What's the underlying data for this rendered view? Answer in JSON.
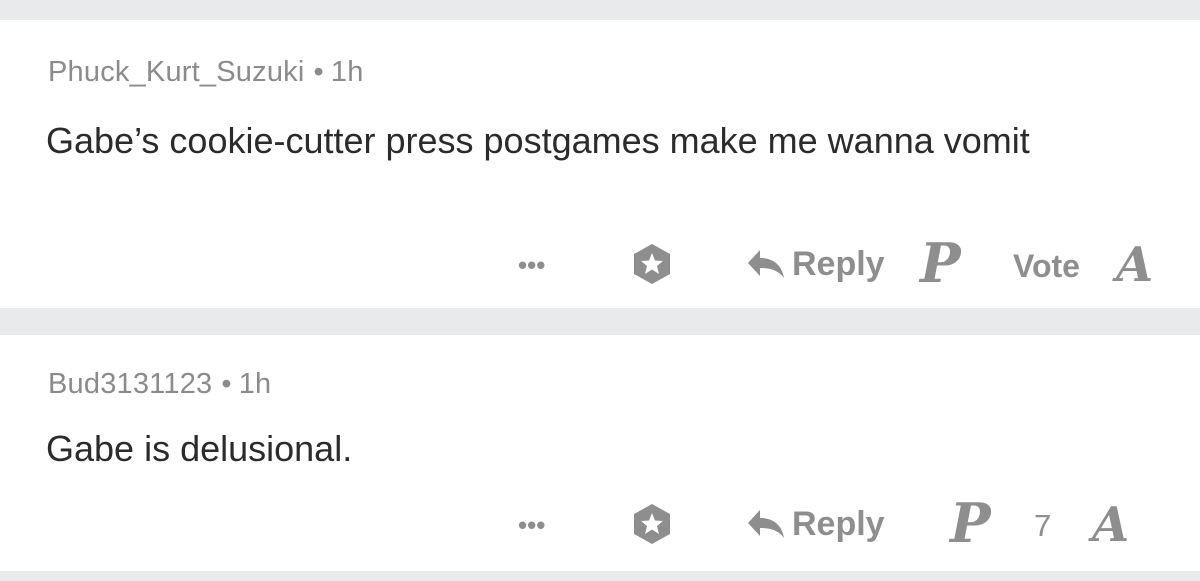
{
  "comments": [
    {
      "username": "Phuck_Kurt_Suzuki",
      "separator": "•",
      "age": "1h",
      "text": "Gabe’s cookie-cutter press postgames make me wanna vomit",
      "actions": {
        "more": "•••",
        "award_icon": "award-icon",
        "reply_label": "Reply",
        "team_logo_left": "P",
        "vote_label": "Vote",
        "team_logo_right": "A"
      }
    },
    {
      "username": "Bud3131123",
      "separator": "•",
      "age": "1h",
      "text": "Gabe is delusional.",
      "actions": {
        "more": "•••",
        "award_icon": "award-icon",
        "reply_label": "Reply",
        "team_logo_left": "P",
        "vote_label": "7",
        "team_logo_right": "A"
      }
    }
  ],
  "colors": {
    "background": "#e9eaec",
    "card": "#ffffff",
    "meta_text": "#8b8b8b",
    "body_text": "#2b2b2b",
    "action_gray": "#8e8e8e"
  }
}
